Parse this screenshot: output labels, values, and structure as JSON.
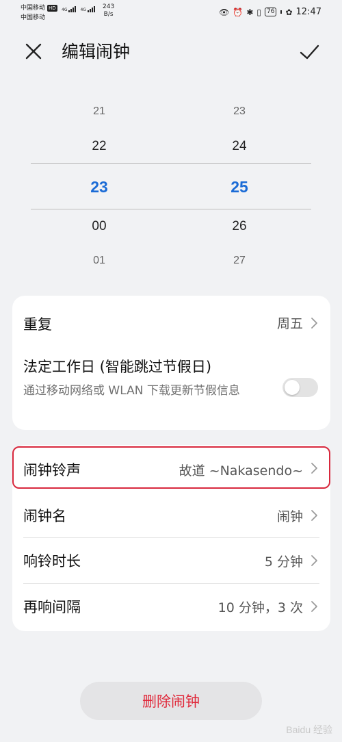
{
  "status_bar": {
    "carrier1": "中国移动",
    "carrier1_badge": "HD",
    "carrier2": "中国移动",
    "signal_tag": "4G",
    "net_speed_value": "243",
    "net_speed_unit": "B/s",
    "battery": "76",
    "time": "12:47"
  },
  "header": {
    "title": "编辑闹钟"
  },
  "picker": {
    "hours": [
      "21",
      "22",
      "23",
      "00",
      "01"
    ],
    "minutes": [
      "23",
      "24",
      "25",
      "26",
      "27"
    ],
    "selected_hour": "23",
    "selected_minute": "25",
    "accent_color": "#1a6bd6"
  },
  "settings_top": {
    "repeat_label": "重复",
    "repeat_value": "周五",
    "workday_label": "法定工作日 (智能跳过节假日)",
    "workday_desc": "通过移动网络或 WLAN 下载更新节假信息",
    "workday_enabled": false
  },
  "settings_bottom": {
    "ringtone_label": "闹钟铃声",
    "ringtone_value": "故道 ~Nakasendo~",
    "name_label": "闹钟名",
    "name_value": "闹钟",
    "duration_label": "响铃时长",
    "duration_value": "5 分钟",
    "snooze_label": "再响间隔",
    "snooze_value": "10 分钟，3 次",
    "highlight_color": "#d8283d"
  },
  "delete_label": "删除闹钟",
  "watermark": "Baidu 经验"
}
